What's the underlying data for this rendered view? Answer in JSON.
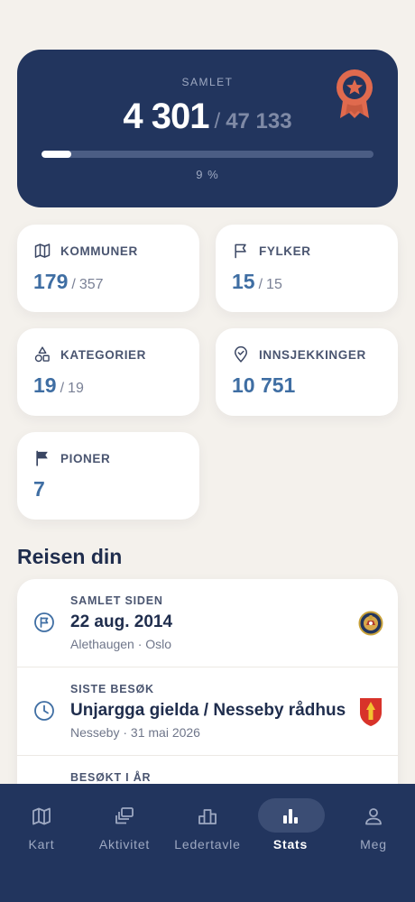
{
  "summary": {
    "label": "SAMLET",
    "value": "4 301",
    "separator": "/",
    "total": "47 133",
    "percent_text": "9 %",
    "progress_fraction": 0.09,
    "medal_icon": "award-ribbon-icon"
  },
  "stats": [
    {
      "icon": "map-icon",
      "title": "KOMMUNER",
      "value": "179",
      "separator": "/",
      "total": "357"
    },
    {
      "icon": "flag-icon",
      "title": "FYLKER",
      "value": "15",
      "separator": "/",
      "total": "15"
    },
    {
      "icon": "shapes-icon",
      "title": "KATEGORIER",
      "value": "19",
      "separator": "/",
      "total": "19"
    },
    {
      "icon": "location-check-icon",
      "title": "INNSJEKKINGER",
      "value": "10 751"
    },
    {
      "icon": "pioneer-flag-icon",
      "title": "PIONER",
      "value": "7"
    }
  ],
  "journey": {
    "title": "Reisen din",
    "items": [
      {
        "icon": "start-flag-icon",
        "label": "SAMLET SIDEN",
        "title": "22 aug. 2014",
        "subtitle": "Alethaugen · Oslo",
        "badge": "oslo-coat-of-arms"
      },
      {
        "icon": "clock-icon",
        "label": "SISTE BESØK",
        "title": "Unjargga gielda / Nesseby rådhus",
        "subtitle": "Nesseby · 31 mai 2026",
        "badge": "nesseby-coat-of-arms"
      },
      {
        "icon": "calendar-icon",
        "label": "BESØKT I ÅR",
        "title": "",
        "subtitle": ""
      }
    ]
  },
  "nav": {
    "items": [
      {
        "icon": "map-icon",
        "label": "Kart"
      },
      {
        "icon": "activity-stack-icon",
        "label": "Aktivitet"
      },
      {
        "icon": "podium-icon",
        "label": "Ledertavle"
      },
      {
        "icon": "bar-chart-icon",
        "label": "Stats",
        "active": true
      },
      {
        "icon": "person-icon",
        "label": "Meg"
      }
    ]
  },
  "colors": {
    "navy": "#22355e",
    "accent_blue": "#3f6ea3",
    "medal_orange": "#e06a4e",
    "background": "#f4f1ec"
  }
}
